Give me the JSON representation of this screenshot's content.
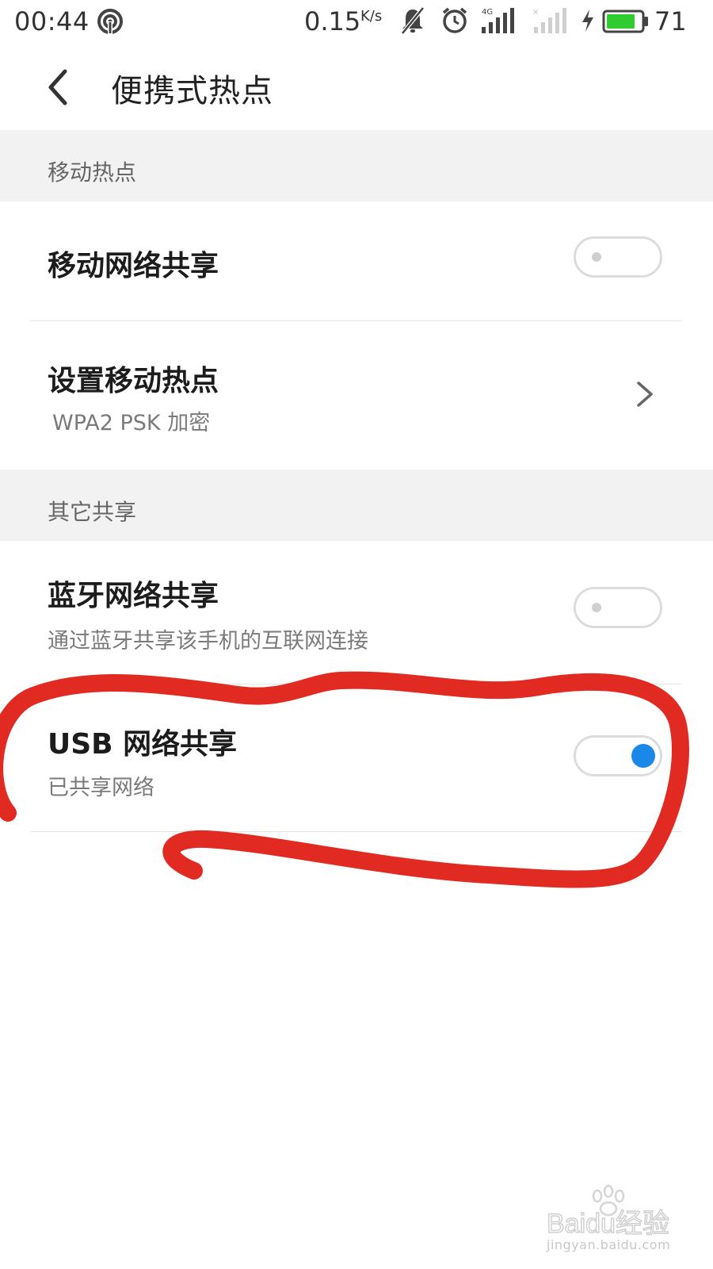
{
  "status_bar": {
    "time": "00:44",
    "net_speed": "0.15",
    "net_speed_unit": "K/s",
    "network_type": "4G",
    "battery_level": "71",
    "battery_color": "#2ecc2e"
  },
  "app_bar": {
    "title": "便携式热点"
  },
  "sections": {
    "mobile_hotspot": {
      "header": "移动热点",
      "items": [
        {
          "title": "移动网络共享",
          "switch_on": false
        },
        {
          "title": "设置移动热点",
          "subtitle": "WPA2 PSK 加密"
        }
      ]
    },
    "other_sharing": {
      "header": "其它共享",
      "items": [
        {
          "title": "蓝牙网络共享",
          "subtitle": "通过蓝牙共享该手机的互联网连接",
          "switch_on": false
        },
        {
          "title": "USB 网络共享",
          "subtitle": "已共享网络",
          "switch_on": true
        }
      ]
    }
  },
  "annotation_color": "#e02a22",
  "accent_color": "#1a88e8",
  "watermark": {
    "brand": "Baidu经验",
    "url": "jingyan.baidu.com"
  }
}
